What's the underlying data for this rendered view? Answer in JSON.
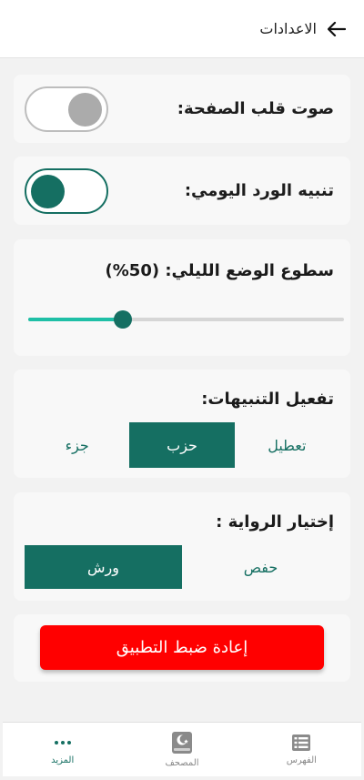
{
  "header": {
    "title": "الاعدادات"
  },
  "settings": {
    "page_flip_sound": {
      "label": "صوت قلب الصفحة:",
      "enabled": false
    },
    "daily_wird_alert": {
      "label": "تنبيه الورد اليومي:",
      "enabled": true
    },
    "night_brightness": {
      "label": "سطوع الوضع الليلي: (50%)",
      "value_percent": 30
    },
    "notifications": {
      "label": "تفعيل التنبيهات:",
      "options": [
        "تعطيل",
        "حزب",
        "جزء"
      ],
      "selected": "حزب"
    },
    "riwaya": {
      "label": "إختيار الرواية :",
      "options": [
        "حفص",
        "ورش"
      ],
      "selected": "ورش"
    },
    "reset_label": "إعادة ضبط التطبيق"
  },
  "bottom_nav": {
    "items": [
      {
        "label": "المزيد",
        "icon": "more-dots-icon",
        "active": true
      },
      {
        "label": "المصحف",
        "icon": "quran-book-icon",
        "active": false
      },
      {
        "label": "الفهرس",
        "icon": "index-list-icon",
        "active": false
      }
    ]
  },
  "colors": {
    "accent": "#156f62",
    "slider_fill": "#1fbfa6",
    "reset": "#ff0000",
    "toggle_off_knob": "#ababab"
  }
}
